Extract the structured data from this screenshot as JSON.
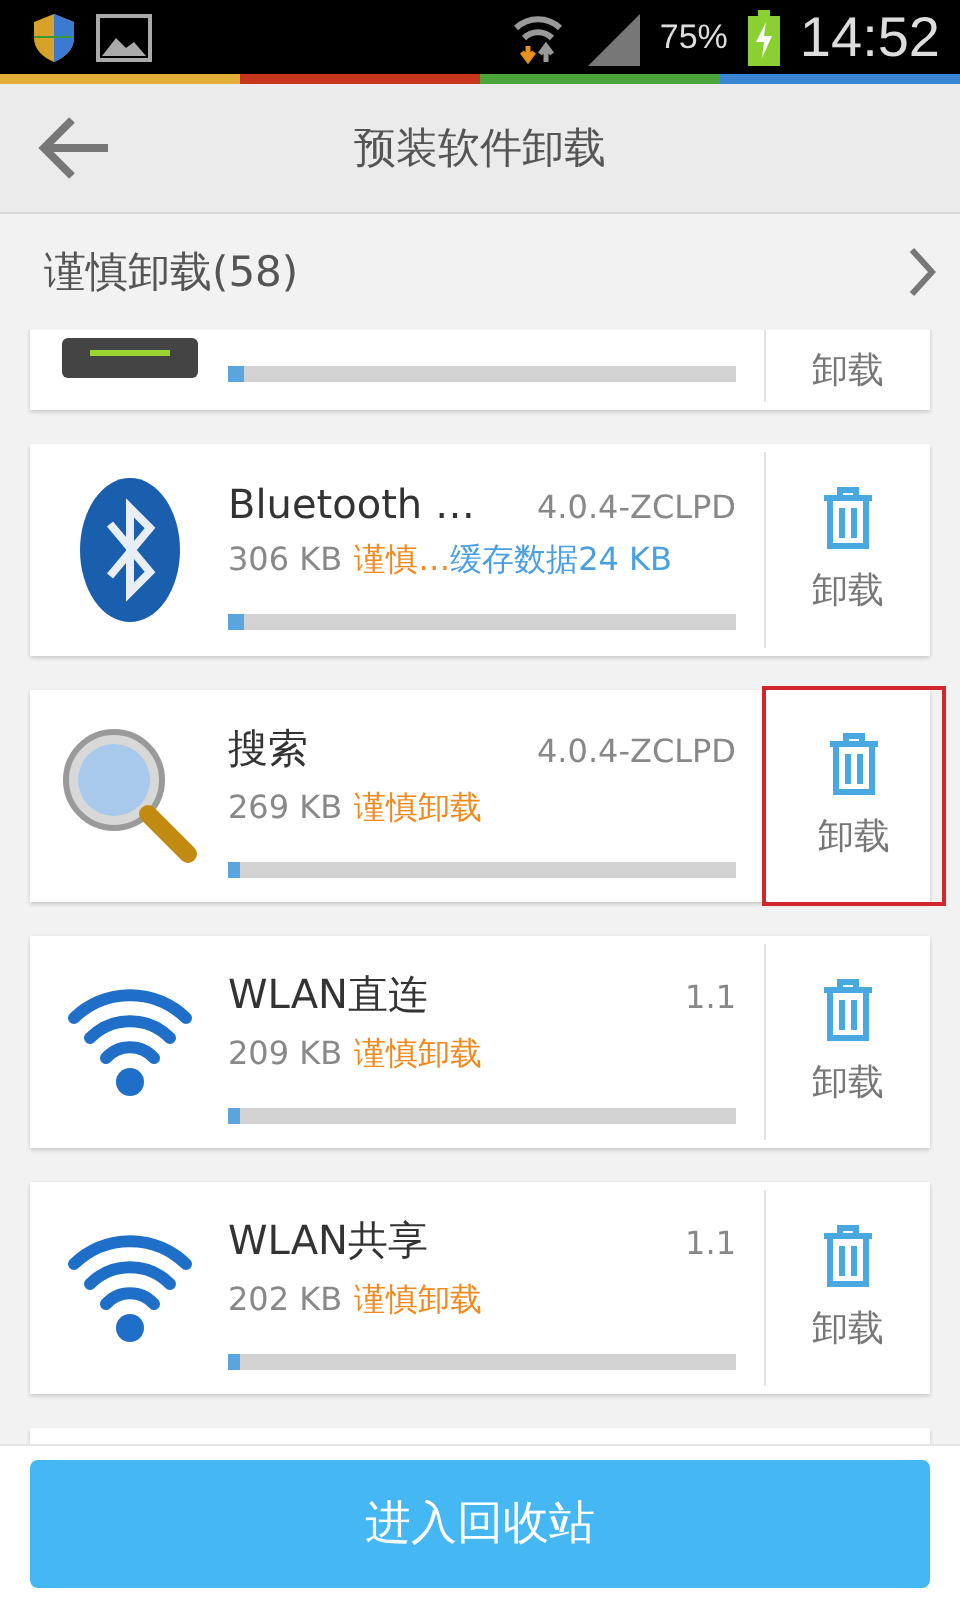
{
  "status_bar": {
    "battery": "75%",
    "time": "14:52"
  },
  "header": {
    "title": "预装软件卸载"
  },
  "section": {
    "title": "谨慎卸载(58)"
  },
  "apps": [
    {
      "kind": "device",
      "cut_off": true,
      "level": 0.03,
      "action": "卸载",
      "highlighted": false
    },
    {
      "kind": "bluetooth",
      "cut_off": false,
      "name": "Bluetooth …",
      "version": "4.0.4-ZCLPD",
      "size": "306 KB",
      "tag": "谨慎…",
      "cache": "缓存数据24 KB",
      "level": 0.03,
      "action": "卸载",
      "highlighted": false
    },
    {
      "kind": "search",
      "cut_off": false,
      "name": "搜索",
      "version": "4.0.4-ZCLPD",
      "size": "269 KB",
      "tag": "谨慎卸载",
      "level": 0.025,
      "action": "卸载",
      "highlighted": true
    },
    {
      "kind": "wifi",
      "cut_off": false,
      "name": "WLAN直连",
      "version": "1.1",
      "size": "209 KB",
      "tag": "谨慎卸载",
      "level": 0.025,
      "action": "卸载",
      "highlighted": false
    },
    {
      "kind": "wifi",
      "cut_off": false,
      "name": "WLAN共享",
      "version": "1.1",
      "size": "202 KB",
      "tag": "谨慎卸载",
      "level": 0.025,
      "action": "卸载",
      "highlighted": false
    },
    {
      "kind": "covered"
    }
  ],
  "footer": {
    "button": "进入回收站"
  }
}
